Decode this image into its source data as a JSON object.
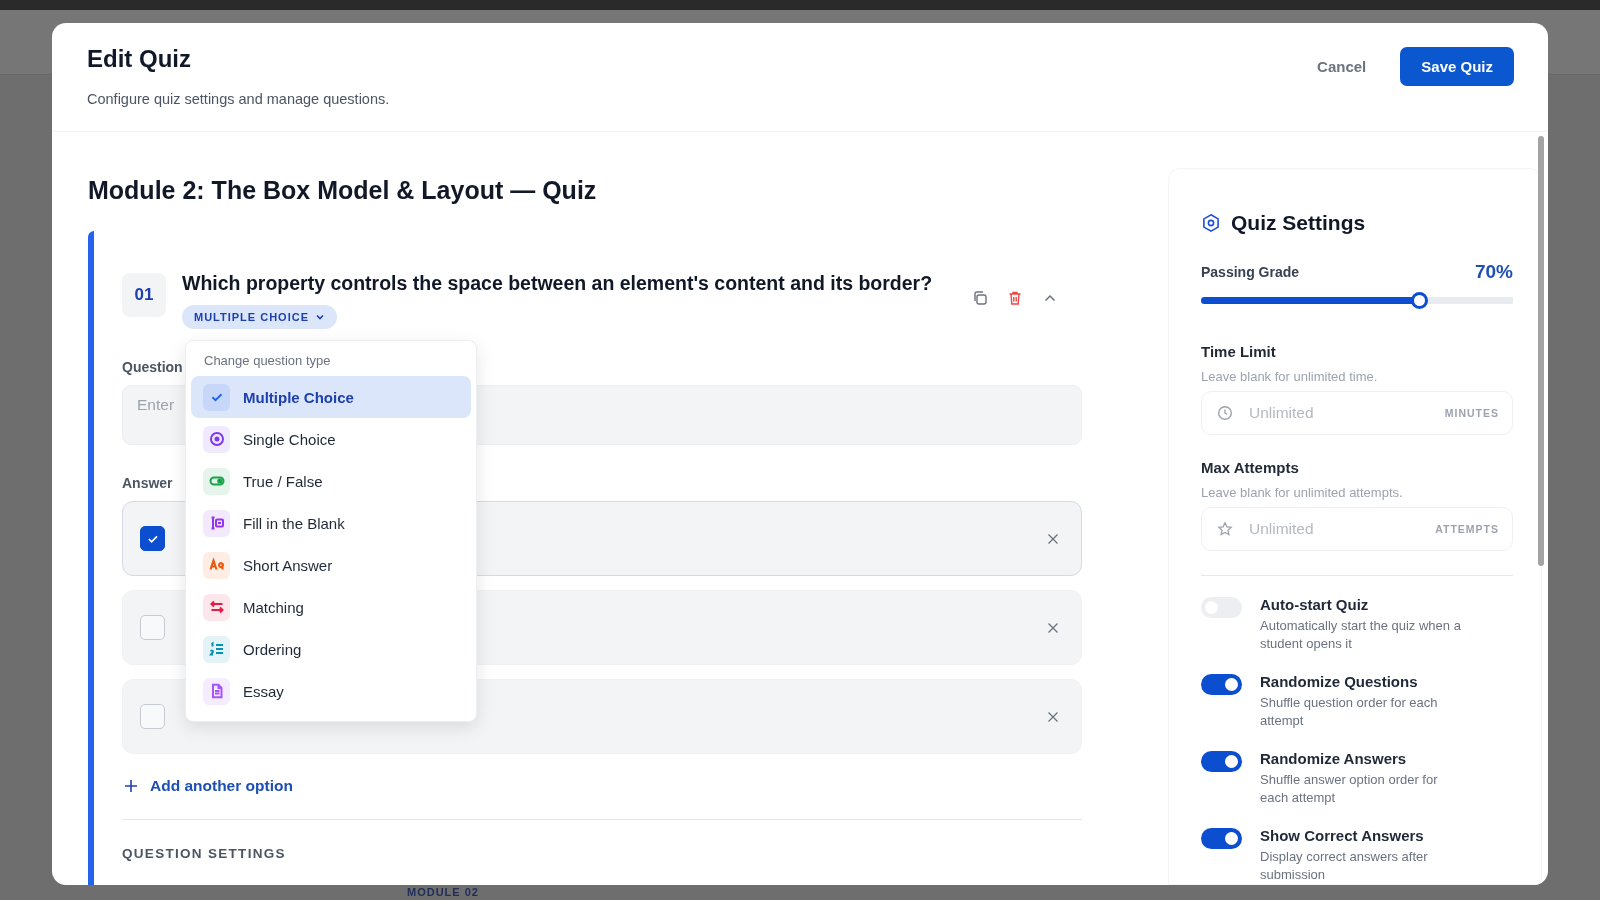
{
  "background": {
    "label": "MODULE 02"
  },
  "header": {
    "title": "Edit Quiz",
    "subtitle": "Configure quiz settings and manage questions.",
    "cancel": "Cancel",
    "save": "Save Quiz"
  },
  "quiz_title": "Module 2: The Box Model & Layout — Quiz",
  "question": {
    "number": "01",
    "text": "Which property controls the space between an element's content and its border?",
    "type": "MULTIPLE CHOICE",
    "question_label": "Question",
    "placeholder": "Enter",
    "answers_label": "Answer",
    "options": [
      {
        "checked": true
      },
      {
        "checked": false
      },
      {
        "checked": false
      }
    ],
    "add_option": "Add another option",
    "settings_heading": "QUESTION SETTINGS"
  },
  "type_menu": {
    "heading": "Change question type",
    "items": [
      {
        "label": "Multiple Choice",
        "kind": "check",
        "color": "#2563eb",
        "selected": true
      },
      {
        "label": "Single Choice",
        "kind": "radio",
        "color": "#7c3aed",
        "selected": false
      },
      {
        "label": "True / False",
        "kind": "toggle",
        "color": "#16a34a",
        "selected": false
      },
      {
        "label": "Fill in the Blank",
        "kind": "blank",
        "color": "#9333ea",
        "selected": false
      },
      {
        "label": "Short Answer",
        "kind": "text",
        "color": "#ea580c",
        "selected": false
      },
      {
        "label": "Matching",
        "kind": "swap",
        "color": "#e11d48",
        "selected": false
      },
      {
        "label": "Ordering",
        "kind": "list",
        "color": "#0891b2",
        "selected": false
      },
      {
        "label": "Essay",
        "kind": "doc",
        "color": "#a855f7",
        "selected": false
      }
    ]
  },
  "settings": {
    "title": "Quiz Settings",
    "passing_grade": {
      "label": "Passing Grade",
      "value": "70%",
      "level": 0.7
    },
    "time_limit": {
      "label": "Time Limit",
      "hint": "Leave blank for unlimited time.",
      "placeholder": "Unlimited",
      "unit": "MINUTES"
    },
    "max_attempts": {
      "label": "Max Attempts",
      "hint": "Leave blank for unlimited attempts.",
      "placeholder": "Unlimited",
      "unit": "ATTEMPTS"
    },
    "toggles": [
      {
        "label": "Auto-start Quiz",
        "description": "Automatically start the quiz when a student opens it",
        "on": false
      },
      {
        "label": "Randomize Questions",
        "description": "Shuffle question order for each attempt",
        "on": true
      },
      {
        "label": "Randomize Answers",
        "description": "Shuffle answer option order for each attempt",
        "on": true
      },
      {
        "label": "Show Correct Answers",
        "description": "Display correct answers after submission",
        "on": true
      }
    ]
  }
}
